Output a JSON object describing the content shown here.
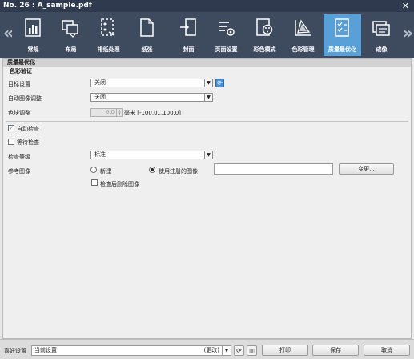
{
  "window": {
    "title": "No. 26 :  A_sample.pdf",
    "close_glyph": "✕"
  },
  "tabs": [
    {
      "label": "常规",
      "icon": "bar-chart-doc-icon"
    },
    {
      "label": "布局",
      "icon": "layout-pages-icon"
    },
    {
      "label": "排纸处理",
      "icon": "finishing-icon"
    },
    {
      "label": "纸张",
      "icon": "paper-icon"
    },
    {
      "label": "封面",
      "icon": "cover-icon"
    },
    {
      "label": "页面设置",
      "icon": "page-settings-icon"
    },
    {
      "label": "彩色模式",
      "icon": "color-mode-icon"
    },
    {
      "label": "色彩管理",
      "icon": "color-management-icon"
    },
    {
      "label": "质量最优化",
      "icon": "quality-checklist-icon",
      "active": true
    },
    {
      "label": "成像",
      "icon": "imaging-icon"
    }
  ],
  "section": {
    "title": "质量最优化",
    "subtitle": "色彩验证",
    "target_label": "目标设置",
    "target_value": "关闭",
    "auto_adjust_label": "自动图像调整",
    "auto_adjust_value": "关闭",
    "patch_label": "色块调整",
    "patch_value": "0.0",
    "patch_unit": "毫米 [-100.0...100.0]",
    "auto_check_label": "自动检查",
    "auto_check_checked": true,
    "wait_check_label": "等待检查",
    "wait_check_checked": false,
    "level_label": "检查等级",
    "level_value": "标准",
    "ref_label": "参考图像",
    "ref_new_label": "新建",
    "ref_use_label": "使用注册的图像",
    "ref_path_value": "",
    "change_button": "变更...",
    "delete_after_label": "检查后删除图像"
  },
  "bottom": {
    "preset_label": "喜好设置",
    "preset_value": "当前设置",
    "preset_changed": "(更改)",
    "print_button": "打印",
    "save_button": "保存",
    "cancel_button": "取消"
  },
  "colors": {
    "titlebar": "#2f3a4e",
    "tabbar": "#3e4a5e",
    "active_tab": "#5aa0d8"
  }
}
